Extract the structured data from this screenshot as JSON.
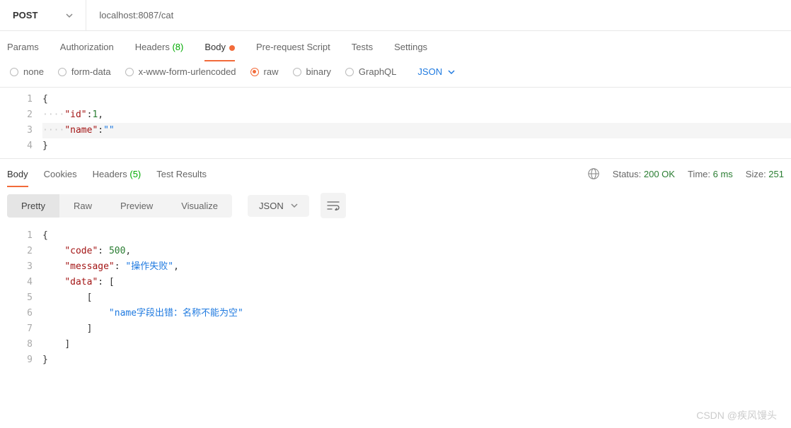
{
  "request": {
    "method": "POST",
    "url": "localhost:8087/cat"
  },
  "request_tabs": [
    {
      "label": "Params"
    },
    {
      "label": "Authorization"
    },
    {
      "label": "Headers ",
      "count": "(8)"
    },
    {
      "label": "Body",
      "active": true,
      "dot": true
    },
    {
      "label": "Pre-request Script"
    },
    {
      "label": "Tests"
    },
    {
      "label": "Settings"
    }
  ],
  "body_types": [
    {
      "label": "none"
    },
    {
      "label": "form-data"
    },
    {
      "label": "x-www-form-urlencoded"
    },
    {
      "label": "raw",
      "checked": true
    },
    {
      "label": "binary"
    },
    {
      "label": "GraphQL"
    }
  ],
  "raw_format": "JSON",
  "request_body": {
    "lines": [
      "1",
      "2",
      "3",
      "4"
    ],
    "key_id": "\"id\"",
    "val_id": "1",
    "key_name": "\"name\"",
    "val_name": "\"\""
  },
  "response_tabs": [
    {
      "label": "Body",
      "active": true
    },
    {
      "label": "Cookies"
    },
    {
      "label": "Headers ",
      "count": "(5)"
    },
    {
      "label": "Test Results"
    }
  ],
  "response_meta": {
    "status_label": "Status: ",
    "status_value": "200 OK",
    "time_label": "Time: ",
    "time_value": "6 ms",
    "size_label": "Size: ",
    "size_value": "251"
  },
  "view_tabs": [
    {
      "label": "Pretty",
      "active": true
    },
    {
      "label": "Raw"
    },
    {
      "label": "Preview"
    },
    {
      "label": "Visualize"
    }
  ],
  "response_format": "JSON",
  "response_body": {
    "lines": [
      "1",
      "2",
      "3",
      "4",
      "5",
      "6",
      "7",
      "8",
      "9"
    ],
    "key_code": "\"code\"",
    "val_code": "500",
    "key_message": "\"message\"",
    "val_message": "\"操作失败\"",
    "key_data": "\"data\"",
    "val_err": "\"name字段出错：名称不能为空\""
  },
  "watermark": "CSDN @疾风馒头",
  "chart_data": {
    "type": "table",
    "title": "Response JSON",
    "data": {
      "code": 500,
      "message": "操作失败",
      "data": [
        [
          "name字段出错：名称不能为空"
        ]
      ]
    }
  }
}
